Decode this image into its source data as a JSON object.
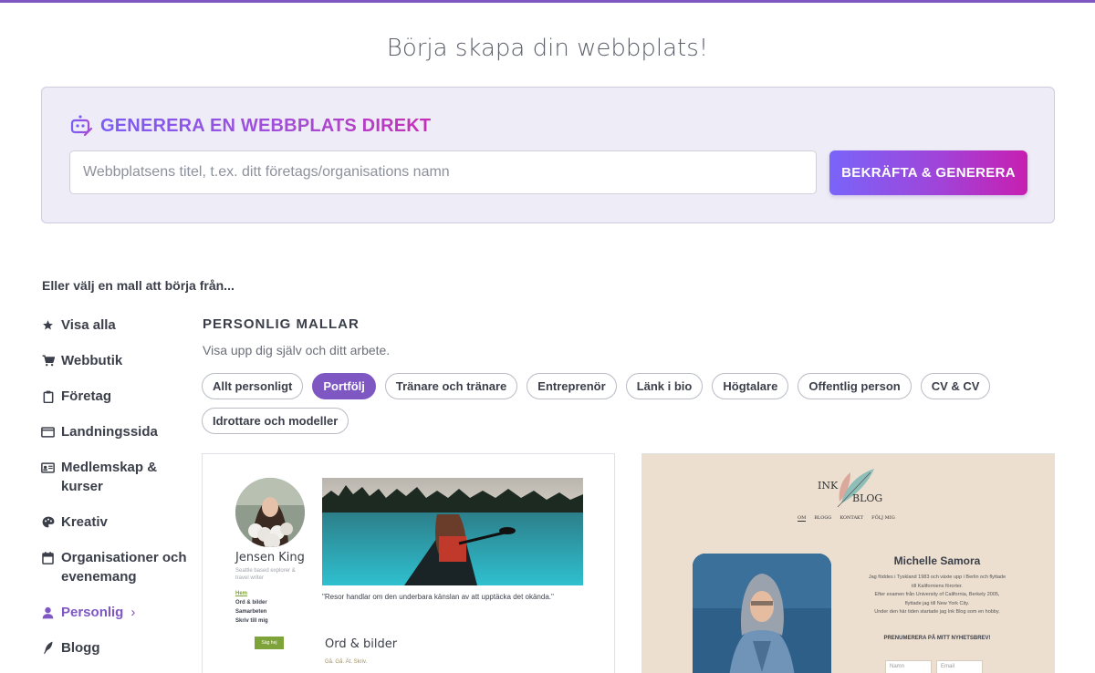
{
  "page_title": "Börja skapa din webbplats!",
  "generator": {
    "title_part1": "GENERERA EN",
    "title_part2": "WEBBPLATS",
    "title_part3": "DIREKT",
    "input_placeholder": "Webbplatsens titel, t.ex. ditt företags/organisations namn",
    "button_label": "BEKRÄFTA & GENERERA"
  },
  "or_text": "Eller välj en mall att börja från...",
  "sidebar": {
    "items": [
      {
        "label": "Visa alla",
        "icon": "star-icon"
      },
      {
        "label": "Webbutik",
        "icon": "cart-icon"
      },
      {
        "label": "Företag",
        "icon": "clipboard-icon"
      },
      {
        "label": "Landningssida",
        "icon": "browser-window-icon"
      },
      {
        "label": "Medlemskap & kurser",
        "icon": "id-card-icon"
      },
      {
        "label": "Kreativ",
        "icon": "palette-icon"
      },
      {
        "label": "Organisationer och evenemang",
        "icon": "calendar-icon"
      },
      {
        "label": "Personlig",
        "icon": "person-icon",
        "active": true
      },
      {
        "label": "Blogg",
        "icon": "quill-icon"
      }
    ],
    "active_chevron": "›"
  },
  "category": {
    "title": "PERSONLIG MALLAR",
    "subtitle": "Visa upp dig själv och ditt arbete."
  },
  "chips": [
    {
      "label": "Allt personligt"
    },
    {
      "label": "Portfölj",
      "active": true
    },
    {
      "label": "Tränare och tränare"
    },
    {
      "label": "Entreprenör"
    },
    {
      "label": "Länk i bio"
    },
    {
      "label": "Högtalare"
    },
    {
      "label": "Offentlig person"
    },
    {
      "label": "CV & CV"
    },
    {
      "label": "Idrottare och modeller"
    }
  ],
  "templates": [
    {
      "name": "Jensen King",
      "tagline": "Seattle based explorer & travel writer",
      "nav": [
        "Hem",
        "Ord & bilder",
        "Samarbeten",
        "Skriv till mig"
      ],
      "button": "Säg hej",
      "quote": "\"Resor handlar om den underbara känslan av att upptäcka det okända.\"",
      "section_title": "Ord & bilder",
      "section_sub": "Gå. Gå. Ät. Skriv."
    },
    {
      "logo_word1": "INK",
      "logo_word2": "BLOG",
      "nav": [
        "OM",
        "BLOGG",
        "KONTAKT",
        "FÖLJ MIG"
      ],
      "name": "Michelle Samora",
      "bio": [
        "Jag föddes i Tyskland 1983 och växte upp i Berlin och flyttade",
        "till Kaliforniens förorter.",
        "Efter examen från University of California, Berkely 2005,",
        "flyttade jag till New York City.",
        "Under den här tiden startade jag Ink Blog som en hobby."
      ],
      "subscribe": "PRENUMERERA PÅ MITT NYHETSBREV!",
      "name_placeholder": "Namn",
      "email_placeholder": "Email"
    }
  ],
  "colors": {
    "accent": "#7e57c2",
    "gradient_start": "#7a64f9",
    "gradient_end": "#c71fb0",
    "generator_bg": "#eeecf6",
    "card2_bg": "#ecdfd0",
    "template_green": "#7ea33b"
  }
}
